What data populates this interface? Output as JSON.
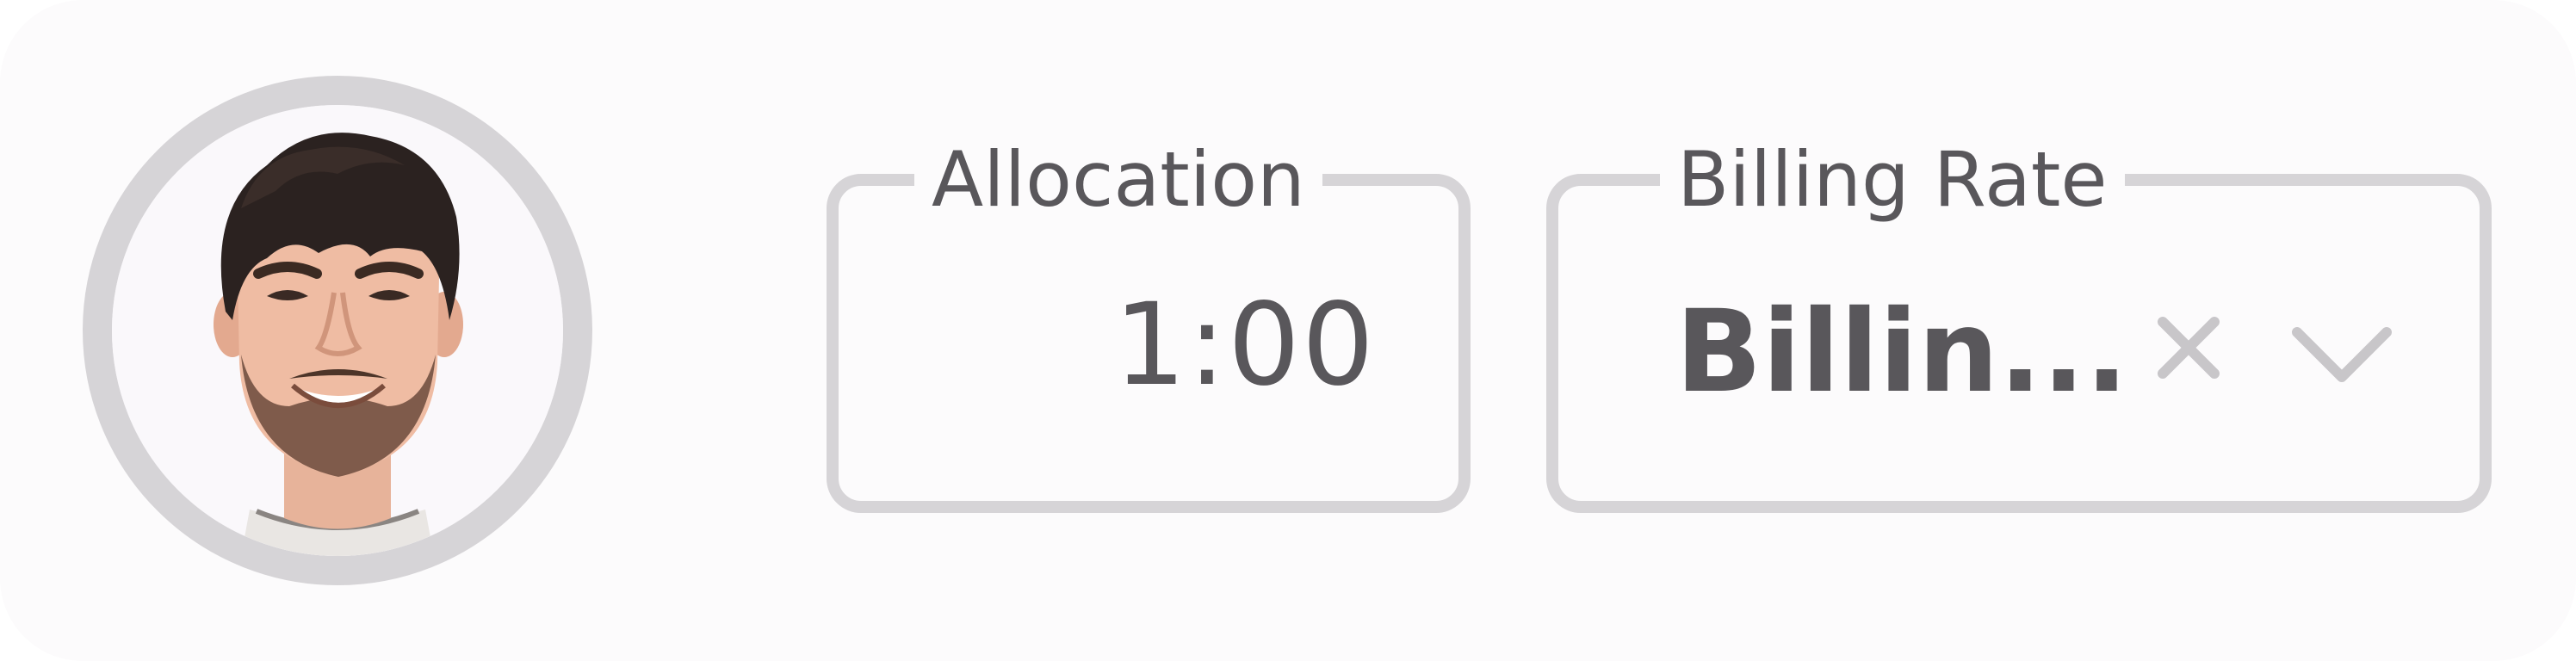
{
  "avatar": {
    "alt": "User avatar"
  },
  "allocation": {
    "label": "Allocation",
    "value": "1:00"
  },
  "billing_rate": {
    "label": "Billing Rate",
    "value": "Billin..."
  },
  "icons": {
    "clear": "close-icon",
    "dropdown": "chevron-down-icon"
  },
  "colors": {
    "background": "#fcfbfc",
    "border": "#d6d4d7",
    "text": "#59575b",
    "icon": "#c8c6c9"
  }
}
